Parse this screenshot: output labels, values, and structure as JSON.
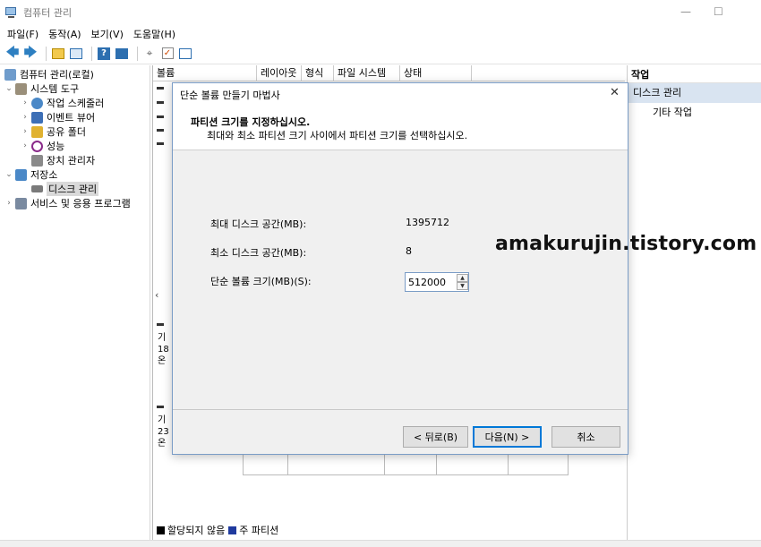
{
  "window": {
    "title": "컴퓨터 관리",
    "minimize": "—",
    "maximize": "☐"
  },
  "menu": [
    "파일(F)",
    "동작(A)",
    "보기(V)",
    "도움말(H)"
  ],
  "tree": {
    "root": "컴퓨터 관리(로컬)",
    "system_tools": "시스템 도구",
    "task_scheduler": "작업 스케줄러",
    "event_viewer": "이벤트 뷰어",
    "shared_folders": "공유 폴더",
    "performance": "성능",
    "device_manager": "장치 관리자",
    "storage": "저장소",
    "disk_management": "디스크 관리",
    "services": "서비스 및 응용 프로그램"
  },
  "table": {
    "columns": [
      "볼륨",
      "레이아웃",
      "형식",
      "파일 시스템",
      "상태"
    ]
  },
  "disk_fragments": {
    "disk1": [
      "기",
      "18",
      "온"
    ],
    "disk2": [
      "기",
      "23",
      "온"
    ]
  },
  "legend": {
    "unallocated": "할당되지 않음",
    "primary": "주 파티션"
  },
  "actions": {
    "title": "작업",
    "disk_management": "디스크 관리",
    "other": "기타 작업"
  },
  "watermark": "amakurujin.tistory.com",
  "dialog": {
    "title": "단순 볼륨 만들기 마법사",
    "heading": "파티션 크기를 지정하십시오.",
    "subheading": "최대와 최소 파티션 크기 사이에서 파티션 크기를 선택하십시오.",
    "max_label": "최대 디스크 공간(MB):",
    "max_value": "1395712",
    "min_label": "최소 디스크 공간(MB):",
    "min_value": "8",
    "size_label": "단순 볼륨 크기(MB)(S):",
    "size_value": "512000",
    "back": "< 뒤로(B)",
    "next": "다음(N) >",
    "cancel": "취소",
    "close": "✕"
  },
  "colors": {
    "unallocated": "#000000",
    "primary": "#1f3a9e",
    "accent": "#0078d7"
  }
}
